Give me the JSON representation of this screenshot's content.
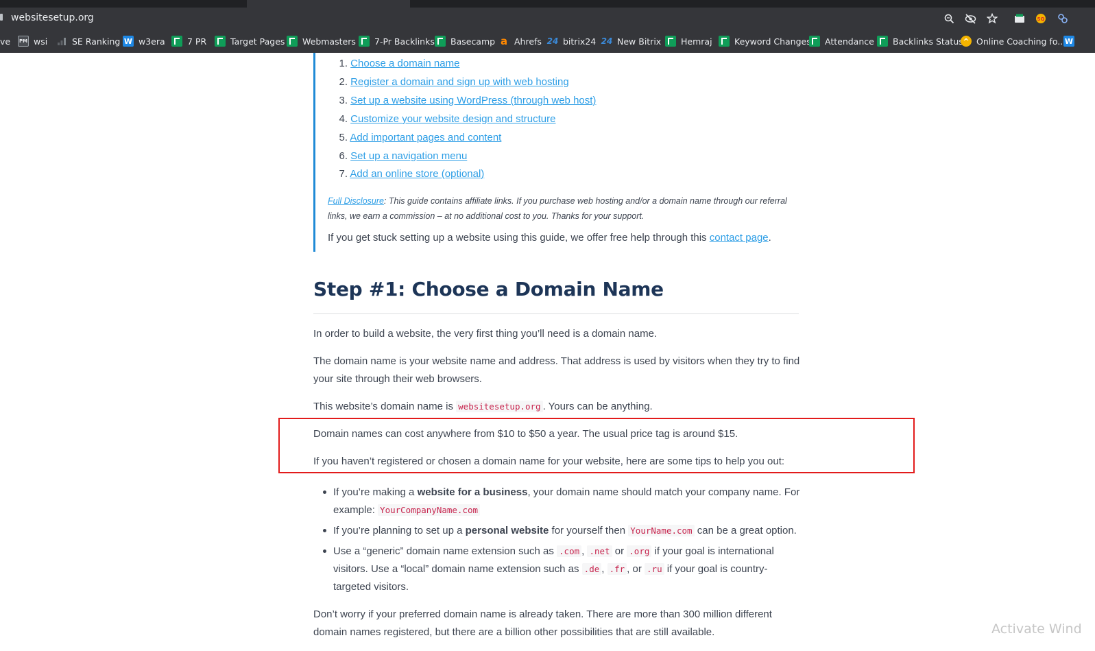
{
  "browser": {
    "url": "websitesetup.org",
    "bookmarks": [
      {
        "label": "ve",
        "icon": "none"
      },
      {
        "label": "wsi",
        "icon": "pm-icon"
      },
      {
        "label": "SE Ranking",
        "icon": "bar-chart-icon"
      },
      {
        "label": "w3era",
        "icon": "w-icon"
      },
      {
        "label": "7 PR",
        "icon": "sheets-icon"
      },
      {
        "label": "Target Pages",
        "icon": "sheets-icon"
      },
      {
        "label": "Webmasters",
        "icon": "sheets-icon"
      },
      {
        "label": "7-Pr Backlinks",
        "icon": "sheets-icon"
      },
      {
        "label": "Basecamp",
        "icon": "sheets-icon"
      },
      {
        "label": "Ahrefs",
        "icon": "ahrefs-icon"
      },
      {
        "label": "bitrix24",
        "icon": "bitrix24-icon"
      },
      {
        "label": "New Bitrix",
        "icon": "bitrix24-icon"
      },
      {
        "label": "Hemraj",
        "icon": "sheets-icon"
      },
      {
        "label": "Keyword Changes",
        "icon": "sheets-icon"
      },
      {
        "label": "Attendance",
        "icon": "sheets-icon"
      },
      {
        "label": "Backlinks Status",
        "icon": "sheets-icon"
      },
      {
        "label": "Online Coaching fo...",
        "icon": "coaching-icon"
      }
    ]
  },
  "toc": {
    "items": [
      {
        "num": "1.",
        "label": "Choose a domain name"
      },
      {
        "num": "2.",
        "label": "Register a domain and sign up with web hosting"
      },
      {
        "num": "3.",
        "label": "Set up a website using WordPress (through web host)"
      },
      {
        "num": "4.",
        "label": "Customize your website design and structure"
      },
      {
        "num": "5.",
        "label": "Add important pages and content"
      },
      {
        "num": "6.",
        "label": "Set up a navigation menu"
      },
      {
        "num": "7.",
        "label": "Add an online store (optional)"
      }
    ],
    "disclosure_link": "Full Disclosure",
    "disclosure_text": ": This guide contains affiliate links. If you purchase web hosting and/or a domain name through our referral links, we earn a commission – at no additional cost to you. Thanks for your support.",
    "stuck_text": "If you get stuck setting up a website using this guide, we offer free help through this ",
    "stuck_link": "contact page",
    "stuck_end": "."
  },
  "section": {
    "heading": "Step #1: Choose a Domain Name",
    "p1": "In order to build a website, the very first thing you’ll need is a domain name.",
    "p2": "The domain name is your website name and address. That address is used by visitors when they try to find your site through their web browsers.",
    "p3_before": "This website’s domain name is ",
    "p3_code": "websitesetup.org",
    "p3_after": ". Yours can be anything.",
    "p4": "Domain names can cost anywhere from $10 to $50 a year. The usual price tag is around $15.",
    "p5": "If you haven’t registered or chosen a domain name for your website, here are some tips to help you out:",
    "b1_a": "If you’re making a ",
    "b1_bold": "website for a business",
    "b1_b": ", your domain name should match your company name. For example: ",
    "b1_code": "YourCompanyName.com",
    "b2_a": "If you’re planning to set up a ",
    "b2_bold": "personal website",
    "b2_b": " for yourself then ",
    "b2_code": "YourName.com",
    "b2_c": " can be a great option.",
    "b3_a": "Use a “generic” domain name extension such as ",
    "b3_c1": ".com",
    "b3_sep1": ", ",
    "b3_c2": ".net",
    "b3_or1": " or ",
    "b3_c3": ".org",
    "b3_b": " if your goal is international visitors. Use a “local” domain name extension such as ",
    "b3_c4": ".de",
    "b3_sep2": ", ",
    "b3_c5": ".fr",
    "b3_or2": ", or ",
    "b3_c6": ".ru",
    "b3_c": " if your goal is country-targeted visitors.",
    "p6": "Don’t worry if your preferred domain name is already taken. There are more than 300 million different domain names registered, but there are a billion other possibilities that are still available."
  },
  "overlay": {
    "activate": "Activate Wind"
  },
  "colors": {
    "link": "#2d9ee6",
    "heading": "#1d3557",
    "highlight_box": "#e21b1b",
    "code": "#c7254e"
  }
}
